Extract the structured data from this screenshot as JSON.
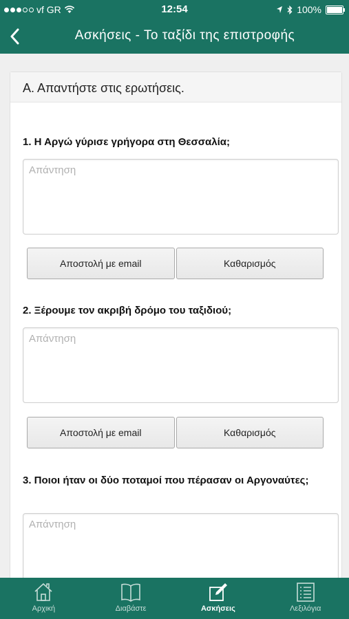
{
  "status": {
    "carrier": "vf GR",
    "time": "12:54",
    "battery": "100%"
  },
  "nav": {
    "title": "Ασκήσεις - Το ταξίδι της επιστροφής"
  },
  "section": {
    "header": "Α. Απαντήστε στις ερωτήσεις."
  },
  "questions": [
    {
      "text": "1. Η Αργώ γύρισε γρήγορα στη Θεσσαλία;",
      "placeholder": "Απάντηση",
      "email_label": "Αποστολή με email",
      "clear_label": "Καθαρισμός"
    },
    {
      "text": "2. Ξέρουμε τον ακριβή δρόμο του ταξιδιού;",
      "placeholder": "Απάντηση",
      "email_label": "Αποστολή με email",
      "clear_label": "Καθαρισμός"
    },
    {
      "text": "3. Ποιοι ήταν οι δύο ποταμοί που πέρασαν οι Αργοναύτες;",
      "placeholder": "Απάντηση"
    }
  ],
  "tabs": [
    {
      "label": "Αρχική",
      "icon": "home-icon",
      "active": false
    },
    {
      "label": "Διαβάστε",
      "icon": "book-icon",
      "active": false
    },
    {
      "label": "Ασκήσεις",
      "icon": "edit-icon",
      "active": true
    },
    {
      "label": "Λεξιλόγια",
      "icon": "list-icon",
      "active": false
    }
  ],
  "colors": {
    "primary": "#1a7362",
    "tab_inactive": "#c7ddd8"
  }
}
